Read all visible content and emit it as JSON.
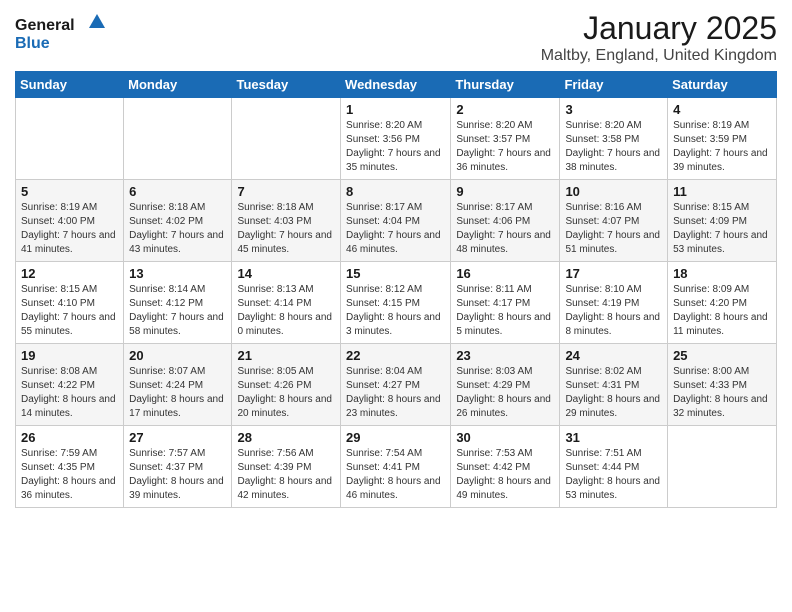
{
  "logo": {
    "general": "General",
    "blue": "Blue"
  },
  "header": {
    "month": "January 2025",
    "location": "Maltby, England, United Kingdom"
  },
  "days_of_week": [
    "Sunday",
    "Monday",
    "Tuesday",
    "Wednesday",
    "Thursday",
    "Friday",
    "Saturday"
  ],
  "weeks": [
    [
      {
        "num": "",
        "info": ""
      },
      {
        "num": "",
        "info": ""
      },
      {
        "num": "",
        "info": ""
      },
      {
        "num": "1",
        "info": "Sunrise: 8:20 AM\nSunset: 3:56 PM\nDaylight: 7 hours and 35 minutes."
      },
      {
        "num": "2",
        "info": "Sunrise: 8:20 AM\nSunset: 3:57 PM\nDaylight: 7 hours and 36 minutes."
      },
      {
        "num": "3",
        "info": "Sunrise: 8:20 AM\nSunset: 3:58 PM\nDaylight: 7 hours and 38 minutes."
      },
      {
        "num": "4",
        "info": "Sunrise: 8:19 AM\nSunset: 3:59 PM\nDaylight: 7 hours and 39 minutes."
      }
    ],
    [
      {
        "num": "5",
        "info": "Sunrise: 8:19 AM\nSunset: 4:00 PM\nDaylight: 7 hours and 41 minutes."
      },
      {
        "num": "6",
        "info": "Sunrise: 8:18 AM\nSunset: 4:02 PM\nDaylight: 7 hours and 43 minutes."
      },
      {
        "num": "7",
        "info": "Sunrise: 8:18 AM\nSunset: 4:03 PM\nDaylight: 7 hours and 45 minutes."
      },
      {
        "num": "8",
        "info": "Sunrise: 8:17 AM\nSunset: 4:04 PM\nDaylight: 7 hours and 46 minutes."
      },
      {
        "num": "9",
        "info": "Sunrise: 8:17 AM\nSunset: 4:06 PM\nDaylight: 7 hours and 48 minutes."
      },
      {
        "num": "10",
        "info": "Sunrise: 8:16 AM\nSunset: 4:07 PM\nDaylight: 7 hours and 51 minutes."
      },
      {
        "num": "11",
        "info": "Sunrise: 8:15 AM\nSunset: 4:09 PM\nDaylight: 7 hours and 53 minutes."
      }
    ],
    [
      {
        "num": "12",
        "info": "Sunrise: 8:15 AM\nSunset: 4:10 PM\nDaylight: 7 hours and 55 minutes."
      },
      {
        "num": "13",
        "info": "Sunrise: 8:14 AM\nSunset: 4:12 PM\nDaylight: 7 hours and 58 minutes."
      },
      {
        "num": "14",
        "info": "Sunrise: 8:13 AM\nSunset: 4:14 PM\nDaylight: 8 hours and 0 minutes."
      },
      {
        "num": "15",
        "info": "Sunrise: 8:12 AM\nSunset: 4:15 PM\nDaylight: 8 hours and 3 minutes."
      },
      {
        "num": "16",
        "info": "Sunrise: 8:11 AM\nSunset: 4:17 PM\nDaylight: 8 hours and 5 minutes."
      },
      {
        "num": "17",
        "info": "Sunrise: 8:10 AM\nSunset: 4:19 PM\nDaylight: 8 hours and 8 minutes."
      },
      {
        "num": "18",
        "info": "Sunrise: 8:09 AM\nSunset: 4:20 PM\nDaylight: 8 hours and 11 minutes."
      }
    ],
    [
      {
        "num": "19",
        "info": "Sunrise: 8:08 AM\nSunset: 4:22 PM\nDaylight: 8 hours and 14 minutes."
      },
      {
        "num": "20",
        "info": "Sunrise: 8:07 AM\nSunset: 4:24 PM\nDaylight: 8 hours and 17 minutes."
      },
      {
        "num": "21",
        "info": "Sunrise: 8:05 AM\nSunset: 4:26 PM\nDaylight: 8 hours and 20 minutes."
      },
      {
        "num": "22",
        "info": "Sunrise: 8:04 AM\nSunset: 4:27 PM\nDaylight: 8 hours and 23 minutes."
      },
      {
        "num": "23",
        "info": "Sunrise: 8:03 AM\nSunset: 4:29 PM\nDaylight: 8 hours and 26 minutes."
      },
      {
        "num": "24",
        "info": "Sunrise: 8:02 AM\nSunset: 4:31 PM\nDaylight: 8 hours and 29 minutes."
      },
      {
        "num": "25",
        "info": "Sunrise: 8:00 AM\nSunset: 4:33 PM\nDaylight: 8 hours and 32 minutes."
      }
    ],
    [
      {
        "num": "26",
        "info": "Sunrise: 7:59 AM\nSunset: 4:35 PM\nDaylight: 8 hours and 36 minutes."
      },
      {
        "num": "27",
        "info": "Sunrise: 7:57 AM\nSunset: 4:37 PM\nDaylight: 8 hours and 39 minutes."
      },
      {
        "num": "28",
        "info": "Sunrise: 7:56 AM\nSunset: 4:39 PM\nDaylight: 8 hours and 42 minutes."
      },
      {
        "num": "29",
        "info": "Sunrise: 7:54 AM\nSunset: 4:41 PM\nDaylight: 8 hours and 46 minutes."
      },
      {
        "num": "30",
        "info": "Sunrise: 7:53 AM\nSunset: 4:42 PM\nDaylight: 8 hours and 49 minutes."
      },
      {
        "num": "31",
        "info": "Sunrise: 7:51 AM\nSunset: 4:44 PM\nDaylight: 8 hours and 53 minutes."
      },
      {
        "num": "",
        "info": ""
      }
    ]
  ]
}
